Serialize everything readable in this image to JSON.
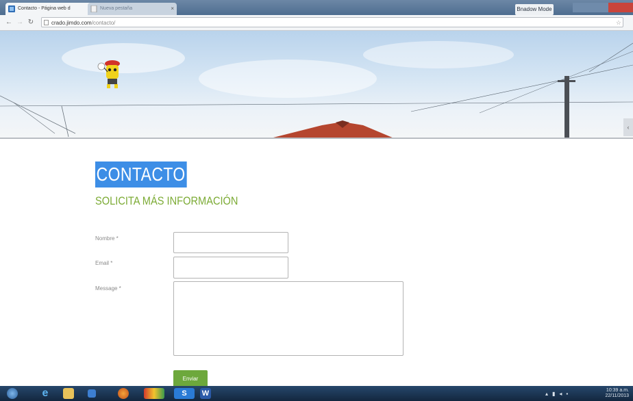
{
  "browser": {
    "tabs": [
      {
        "label": "Contacto - Página web d"
      },
      {
        "label": "Nueva pestaña"
      }
    ],
    "incognito_label": "Bnadow Mode",
    "url_domain": "crado.jimdo.com",
    "url_path": "/contacto/"
  },
  "page": {
    "title": "CONTACTO",
    "subtitle": "SOLICITA MÁS INFORMACIÓN",
    "form": {
      "name_label": "Nombre *",
      "email_label": "Email *",
      "message_label": "Message *",
      "submit_label": "Enviar"
    }
  },
  "taskbar": {
    "time": "10:39 a.m.",
    "date": "22/11/2013"
  },
  "colors": {
    "heading_highlight": "#3d8ee6",
    "subtitle": "#7cab35",
    "submit_button": "#6da83c"
  }
}
